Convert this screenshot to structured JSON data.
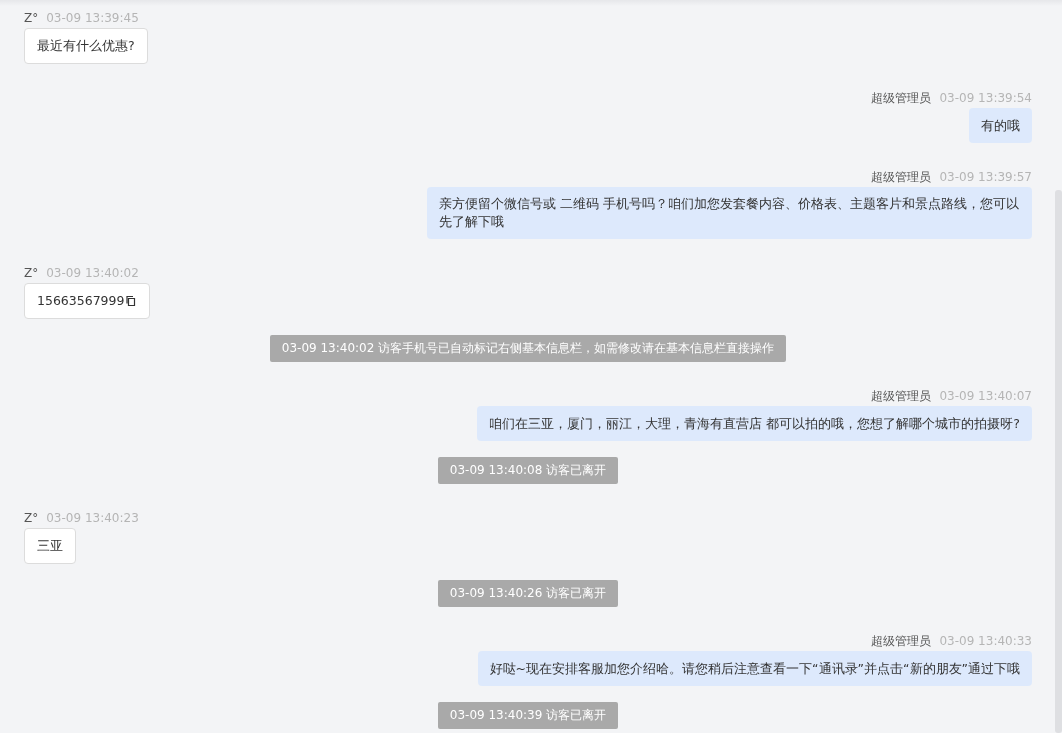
{
  "messages": [
    {
      "kind": "visitor",
      "sender": "Z°",
      "time": "03-09 13:39:45",
      "text": "最近有什么优惠?",
      "copyable": false
    },
    {
      "kind": "agent",
      "sender": "超级管理员",
      "time": "03-09 13:39:54",
      "text": "有的哦"
    },
    {
      "kind": "agent",
      "sender": "超级管理员",
      "time": "03-09 13:39:57",
      "text": "亲方便留个微信号或 二维码 手机号吗？咱们加您发套餐内容、价格表、主题客片和景点路线，您可以先了解下哦"
    },
    {
      "kind": "visitor",
      "sender": "Z°",
      "time": "03-09 13:40:02",
      "text": "15663567999",
      "copyable": true
    },
    {
      "kind": "system",
      "text": "03-09 13:40:02 访客手机号已自动标记右侧基本信息栏，如需修改请在基本信息栏直接操作"
    },
    {
      "kind": "agent",
      "sender": "超级管理员",
      "time": "03-09 13:40:07",
      "text": "咱们在三亚，厦门，丽江，大理，青海有直营店 都可以拍的哦，您想了解哪个城市的拍摄呀?"
    },
    {
      "kind": "system",
      "text": "03-09 13:40:08 访客已离开"
    },
    {
      "kind": "visitor",
      "sender": "Z°",
      "time": "03-09 13:40:23",
      "text": "三亚",
      "copyable": false
    },
    {
      "kind": "system",
      "text": "03-09 13:40:26 访客已离开"
    },
    {
      "kind": "agent",
      "sender": "超级管理员",
      "time": "03-09 13:40:33",
      "text": "好哒~现在安排客服加您介绍哈。请您稍后注意查看一下“通讯录”并点击“新的朋友”通过下哦"
    },
    {
      "kind": "system",
      "text": "03-09 13:40:39 访客已离开"
    }
  ]
}
